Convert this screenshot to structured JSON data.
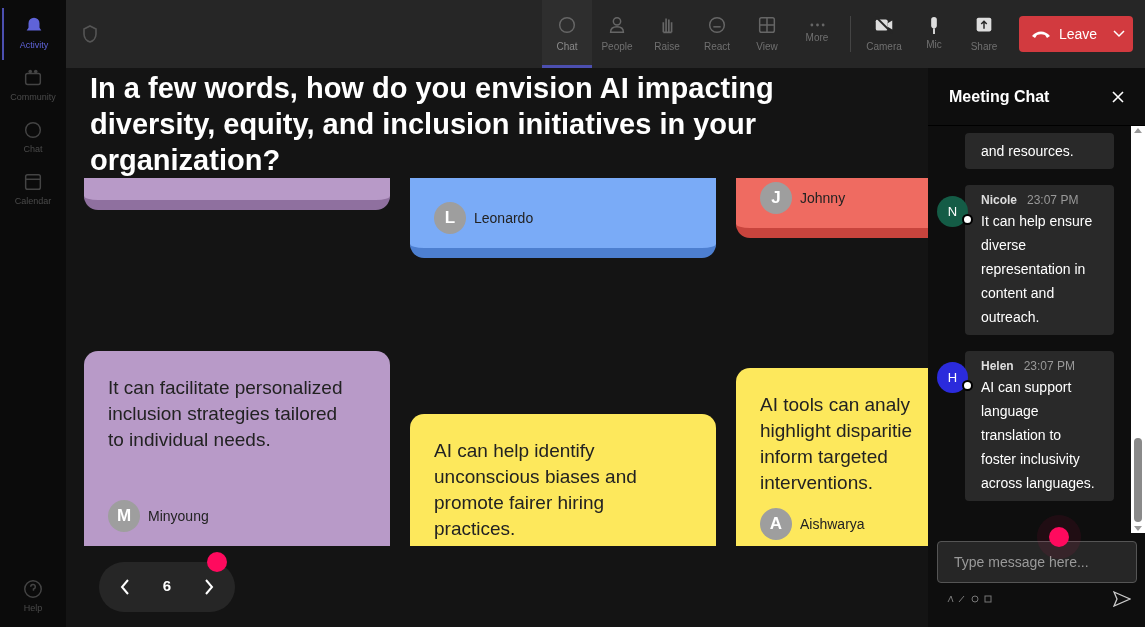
{
  "sidebar": {
    "items": [
      {
        "label": "Activity",
        "selected": true
      },
      {
        "label": "Community",
        "selected": false
      },
      {
        "label": "Chat",
        "selected": false
      },
      {
        "label": "Calendar",
        "selected": false
      }
    ],
    "help": "Help"
  },
  "toolbar": {
    "items": [
      {
        "label": "Chat",
        "selected": true
      },
      {
        "label": "People",
        "selected": false
      },
      {
        "label": "Raise",
        "selected": false
      },
      {
        "label": "React",
        "selected": false
      },
      {
        "label": "View",
        "selected": false
      },
      {
        "label": "More",
        "selected": false
      }
    ],
    "controls": [
      "Camera",
      "Mic",
      "Share"
    ],
    "leave": "Leave"
  },
  "question": "In a few words, how do you envision AI impacting diversity, equity, and inclusion initiatives in your organization?",
  "board": {
    "columns": [
      {
        "cards": [
          {
            "color": "#b89ac8"
          },
          {
            "color": "#b89ac8",
            "text": "It can facilitate personalized inclusion strategies tailored to individual needs.",
            "author": "Minyoung",
            "initial": "M"
          }
        ]
      },
      {
        "cards": [
          {
            "color": "#7aabf7",
            "author": "Leonardo",
            "initial": "L"
          },
          {
            "color": "#fde85c",
            "text": "AI can help identify unconscious biases and promote fairer hiring practices."
          }
        ]
      },
      {
        "cards": [
          {
            "color": "#ef6b61",
            "author": "Johnny",
            "initial": "J"
          },
          {
            "color": "#fde85c",
            "text": "AI tools can analy\nhighlight disparitie\ninform targeted\ninterventions.",
            "author": "Aishwarya",
            "initial": "A"
          }
        ]
      }
    ]
  },
  "pager": {
    "page": "6"
  },
  "chat": {
    "title": "Meeting Chat",
    "messages": [
      {
        "text": "and resources."
      },
      {
        "author": "Nicole",
        "time": "23:07 PM",
        "initial": "N",
        "color": "#145c46",
        "text": "It can help ensure diverse representation in content and outreach."
      },
      {
        "author": "Helen",
        "time": "23:07 PM",
        "initial": "H",
        "color": "#2b2bdc",
        "text": "AI can support language translation to foster inclusivity across languages."
      }
    ],
    "placeholder": "Type message here..."
  }
}
